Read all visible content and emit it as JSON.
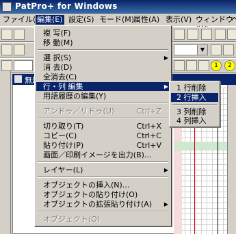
{
  "window": {
    "title": "PatPro+ for Windows"
  },
  "menubar": [
    "ファイル(F)",
    "編集(E)",
    "設定(S)",
    "モード(M)",
    "属性(A)",
    "表示(V)",
    "ウィンドウ(W)",
    "ヘ"
  ],
  "document": {
    "title": "無題"
  },
  "edit_menu": {
    "items": [
      {
        "label": "複 写(F)"
      },
      {
        "label": "移 動(M)"
      },
      {
        "label": "選 択(S)",
        "submenu": true
      },
      {
        "label": "消 去(D)"
      },
      {
        "label": "全消去(C)"
      },
      {
        "label": "行・列 編集",
        "submenu": true,
        "highlighted": true
      },
      {
        "label": "用語履歴の編集(Y)"
      },
      {
        "label": "アンドゥ／リドゥ(U)",
        "shortcut": "Ctrl+Z",
        "disabled": true
      },
      {
        "label": "切り取り(T)",
        "shortcut": "Ctrl+X"
      },
      {
        "label": "コピー(C)",
        "shortcut": "Ctrl+C"
      },
      {
        "label": "貼り付け(P)",
        "shortcut": "Ctrl+V"
      },
      {
        "label": "画面／印刷イメージを出力(B)..."
      },
      {
        "label": "レイヤー(L)",
        "submenu": true
      },
      {
        "label": "オブジェクトの挿入(N)..."
      },
      {
        "label": "オブジェクトの貼り付け(O)"
      },
      {
        "label": "オブジェクトの拡張貼り付け(A)",
        "submenu": true
      },
      {
        "label": "オブジェクト(O)",
        "disabled": true
      }
    ]
  },
  "rowcol_submenu": {
    "items": [
      {
        "label": "1 行削除"
      },
      {
        "label": "2 行挿入",
        "highlighted": true
      },
      {
        "label": "3 列削除"
      },
      {
        "label": "4 列挿入"
      }
    ]
  },
  "toolbar": {
    "circle_buttons": [
      "1",
      "2"
    ]
  }
}
